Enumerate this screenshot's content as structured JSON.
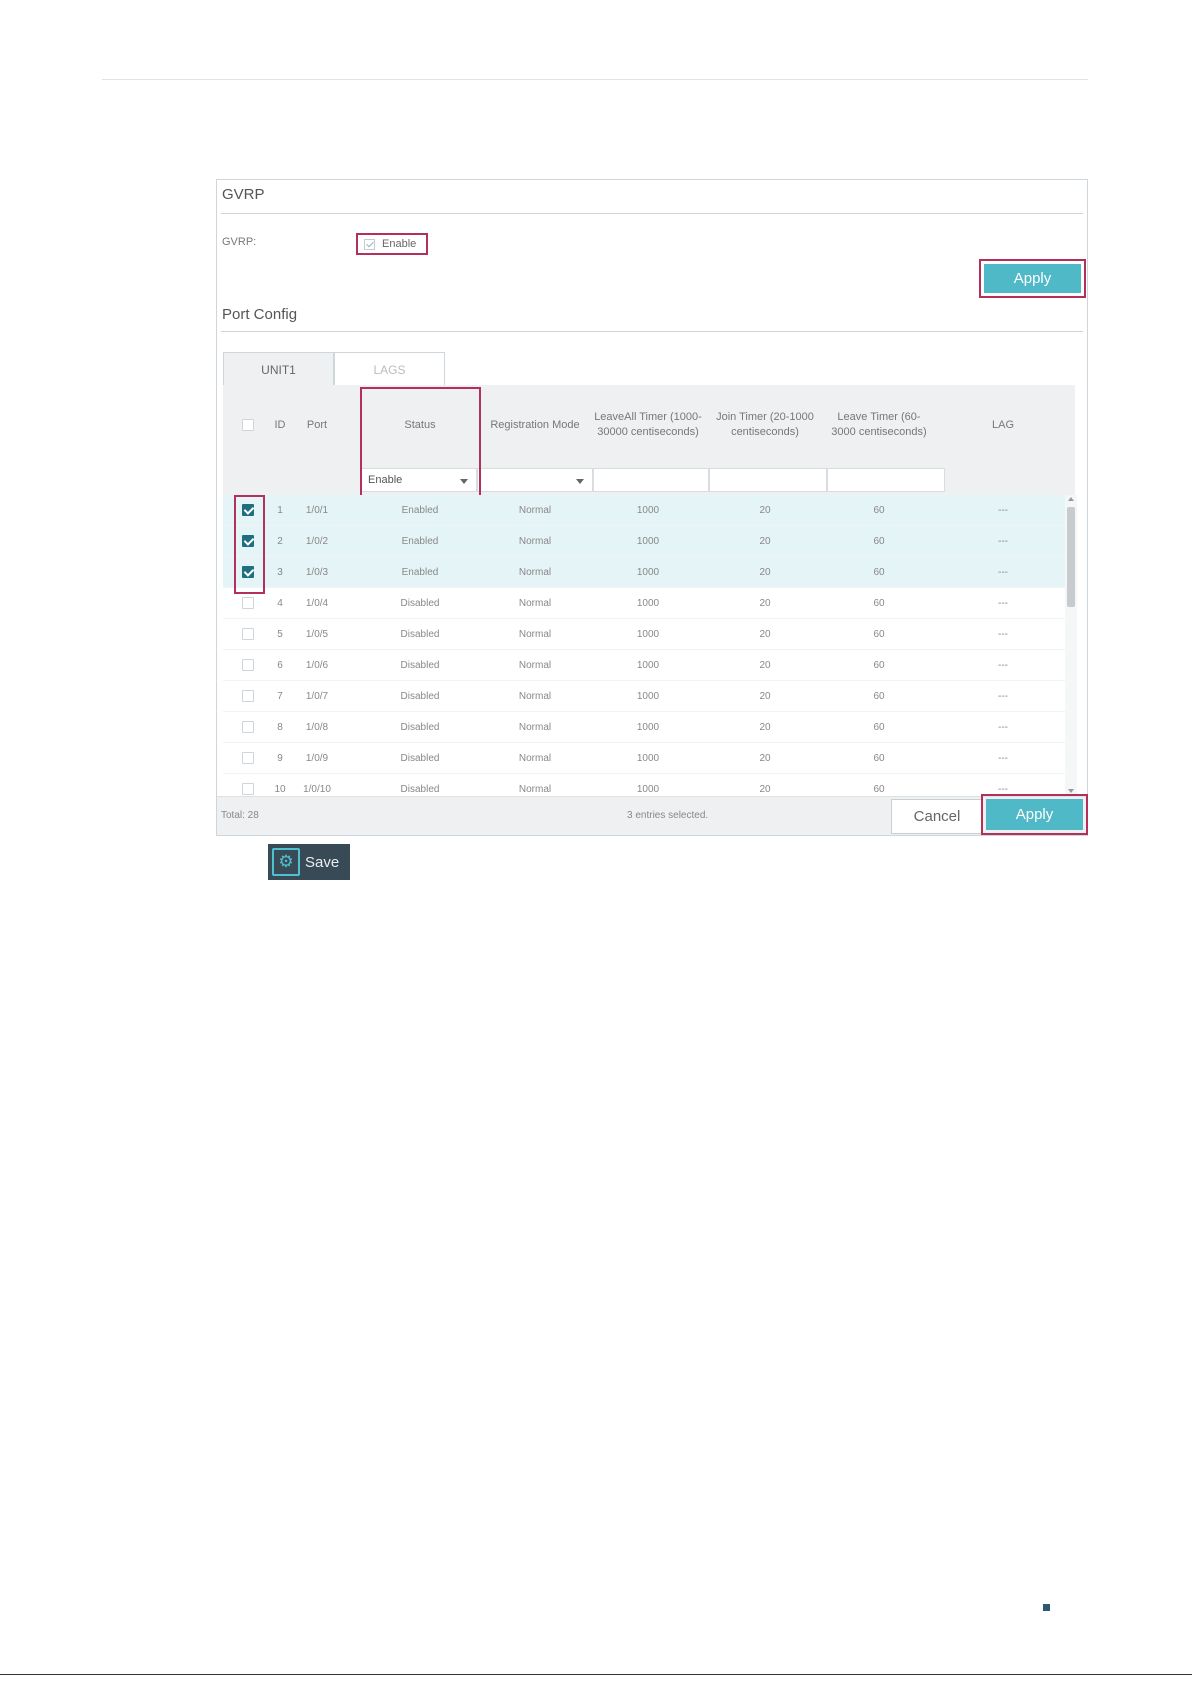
{
  "gvrp": {
    "section_title": "GVRP",
    "field_label": "GVRP:",
    "enable_label": "Enable",
    "enable_checked": true,
    "apply_label": "Apply"
  },
  "port_config": {
    "section_title": "Port Config",
    "tabs": [
      {
        "label": "UNIT1",
        "active": true
      },
      {
        "label": "LAGS",
        "active": false
      }
    ],
    "columns": {
      "id": "ID",
      "port": "Port",
      "status": "Status",
      "registration_mode": "Registration Mode",
      "leaveall_timer": "LeaveAll Timer (1000-30000 centiseconds)",
      "join_timer": "Join Timer (20-1000 centiseconds)",
      "leave_timer": "Leave Timer (60-3000 centiseconds)",
      "lag": "LAG"
    },
    "filters": {
      "status_value": "Enable",
      "registration_value": "",
      "leaveall_value": "",
      "join_value": "",
      "leave_value": ""
    },
    "rows": [
      {
        "id": "1",
        "port": "1/0/1",
        "status": "Enabled",
        "mode": "Normal",
        "leaveall": "1000",
        "join": "20",
        "leave": "60",
        "lag": "---",
        "checked": true
      },
      {
        "id": "2",
        "port": "1/0/2",
        "status": "Enabled",
        "mode": "Normal",
        "leaveall": "1000",
        "join": "20",
        "leave": "60",
        "lag": "---",
        "checked": true
      },
      {
        "id": "3",
        "port": "1/0/3",
        "status": "Enabled",
        "mode": "Normal",
        "leaveall": "1000",
        "join": "20",
        "leave": "60",
        "lag": "---",
        "checked": true
      },
      {
        "id": "4",
        "port": "1/0/4",
        "status": "Disabled",
        "mode": "Normal",
        "leaveall": "1000",
        "join": "20",
        "leave": "60",
        "lag": "---",
        "checked": false
      },
      {
        "id": "5",
        "port": "1/0/5",
        "status": "Disabled",
        "mode": "Normal",
        "leaveall": "1000",
        "join": "20",
        "leave": "60",
        "lag": "---",
        "checked": false
      },
      {
        "id": "6",
        "port": "1/0/6",
        "status": "Disabled",
        "mode": "Normal",
        "leaveall": "1000",
        "join": "20",
        "leave": "60",
        "lag": "---",
        "checked": false
      },
      {
        "id": "7",
        "port": "1/0/7",
        "status": "Disabled",
        "mode": "Normal",
        "leaveall": "1000",
        "join": "20",
        "leave": "60",
        "lag": "---",
        "checked": false
      },
      {
        "id": "8",
        "port": "1/0/8",
        "status": "Disabled",
        "mode": "Normal",
        "leaveall": "1000",
        "join": "20",
        "leave": "60",
        "lag": "---",
        "checked": false
      },
      {
        "id": "9",
        "port": "1/0/9",
        "status": "Disabled",
        "mode": "Normal",
        "leaveall": "1000",
        "join": "20",
        "leave": "60",
        "lag": "---",
        "checked": false
      },
      {
        "id": "10",
        "port": "1/0/10",
        "status": "Disabled",
        "mode": "Normal",
        "leaveall": "1000",
        "join": "20",
        "leave": "60",
        "lag": "---",
        "checked": false
      }
    ],
    "footer": {
      "total": "Total: 28",
      "selected_info": "3 entries selected.",
      "cancel_label": "Cancel",
      "apply_label": "Apply"
    }
  },
  "save": {
    "label": "Save",
    "icon": "gear-save-icon"
  },
  "colors": {
    "highlight": "#b3305a",
    "accent": "#4fb9c8",
    "selected_row": "#e5f4f6",
    "checkbox_on": "#1f6f80"
  }
}
